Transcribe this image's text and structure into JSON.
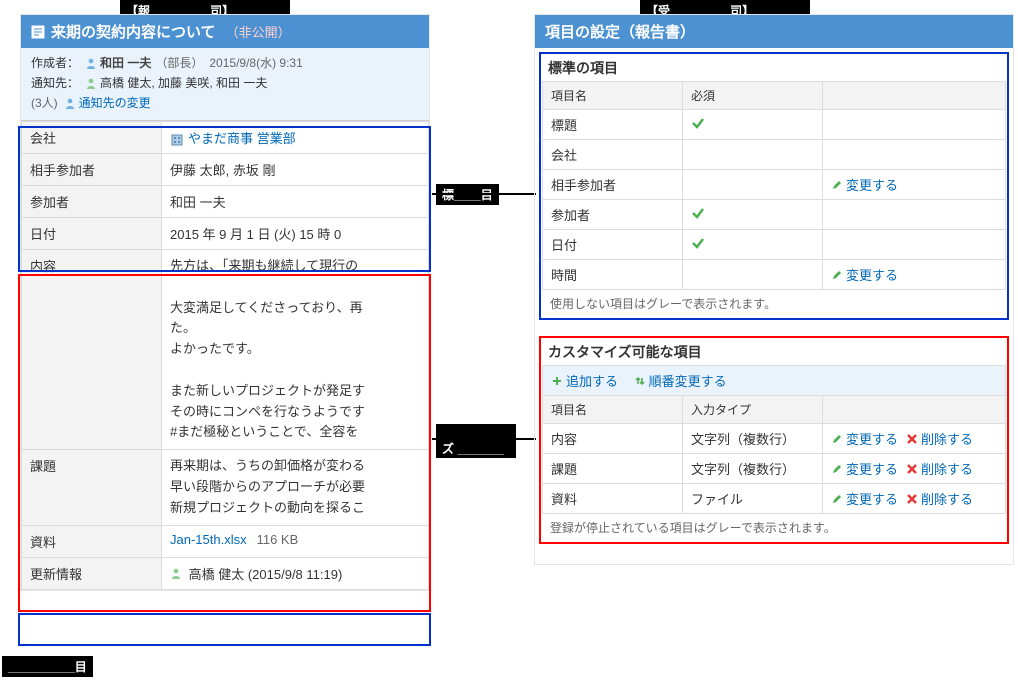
{
  "labels": {
    "top1": "【報_________司】",
    "top2": "【受_________司】",
    "mid1": "標____目",
    "mid2": "__________ズ\n_______目",
    "bot1": "__________目"
  },
  "report": {
    "title": "来期の契約内容について",
    "visibility": "（非公開）",
    "meta": {
      "creatorLabel": "作成者：",
      "creatorName": "和田 一夫",
      "creatorRole": "（部長）",
      "createdAt": "2015/9/8(水) 9:31",
      "notifyLabel": "通知先：",
      "notifyPeople": "高橋 健太, 加藤 美咲, 和田 一夫",
      "notifyCount": "(3人)",
      "changeNotify": "通知先の変更"
    },
    "rows": [
      {
        "label": "会社",
        "company": "やまだ商事 営業部"
      },
      {
        "label": "相手参加者",
        "text": "伊藤 太郎, 赤坂 剛"
      },
      {
        "label": "参加者",
        "text": "和田 一夫"
      },
      {
        "label": "日付",
        "text": "2015 年 9 月 1 日 (火) 15 時 0"
      },
      {
        "label": "内容",
        "multiline": "先方は、「来期も継続して現行の\n\n大変満足してくださっており、再\nた。\nよかったです。\n\nまた新しいプロジェクトが発足す\nその時にコンペを行なうようです\n#まだ極秘ということで、全容を"
      },
      {
        "label": "課題",
        "multiline": "再来期は、うちの卸価格が変わる\n早い段階からのアプローチが必要\n新規プロジェクトの動向を探るこ"
      },
      {
        "label": "資料",
        "file": {
          "name": "Jan-15th.xlsx",
          "size": "116 KB"
        }
      },
      {
        "label": "更新情報",
        "updater": "高橋 健太 (2015/9/8 11:19)"
      }
    ]
  },
  "settings": {
    "title": "項目の設定（報告書）",
    "standard": {
      "title": "標準の項目",
      "cols": [
        "項目名",
        "必須",
        ""
      ],
      "rows": [
        {
          "name": "標題",
          "required": true
        },
        {
          "name": "会社",
          "required": false
        },
        {
          "name": "相手参加者",
          "required": false,
          "action": "変更する"
        },
        {
          "name": "参加者",
          "required": true
        },
        {
          "name": "日付",
          "required": true
        },
        {
          "name": "時間",
          "required": false,
          "action": "変更する"
        }
      ],
      "note": "使用しない項目はグレーで表示されます。"
    },
    "custom": {
      "title": "カスタマイズ可能な項目",
      "add": "追加する",
      "reorder": "順番変更する",
      "cols": [
        "項目名",
        "入力タイプ",
        ""
      ],
      "rows": [
        {
          "name": "内容",
          "type": "文字列（複数行）",
          "edit": "変更する",
          "del": "削除する"
        },
        {
          "name": "課題",
          "type": "文字列（複数行）",
          "edit": "変更する",
          "del": "削除する"
        },
        {
          "name": "資料",
          "type": "ファイル",
          "edit": "変更する",
          "del": "削除する"
        }
      ],
      "note": "登録が停止されている項目はグレーで表示されます。"
    }
  }
}
